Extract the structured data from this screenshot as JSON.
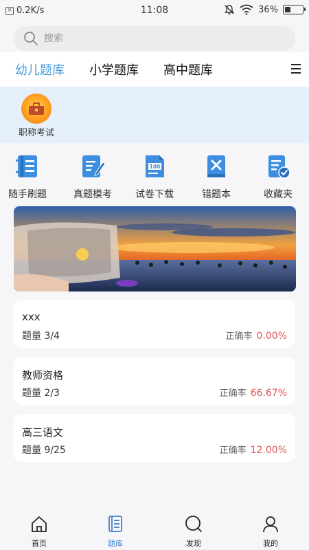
{
  "status_bar": {
    "network_speed": "0.2K/s",
    "time": "11:08",
    "battery": "36%",
    "battery_level": 0.36
  },
  "search": {
    "placeholder": "搜索",
    "value": ""
  },
  "tabs": [
    {
      "label": "幼儿题库",
      "active": true
    },
    {
      "label": "小学题库",
      "active": false
    },
    {
      "label": "高中题库",
      "active": false
    }
  ],
  "categories": [
    {
      "label": "职称考试",
      "icon": "briefcase-badge-icon"
    }
  ],
  "tools": [
    {
      "label": "随手刷题",
      "icon": "practice-book-icon"
    },
    {
      "label": "真题模考",
      "icon": "edit-paper-icon"
    },
    {
      "label": "试卷下载",
      "icon": "score-paper-icon"
    },
    {
      "label": "错题本",
      "icon": "wrong-book-icon"
    },
    {
      "label": "收藏夹",
      "icon": "favorites-check-icon"
    }
  ],
  "banner": {
    "alt": "sunset-sea-phone-photo"
  },
  "question_banks": [
    {
      "name": "xxx",
      "count": "题量 3/4",
      "rate_label": "正确率",
      "rate": "0.00%"
    },
    {
      "name": "教师资格",
      "count": "题量 2/3",
      "rate_label": "正确率",
      "rate": "66.67%"
    },
    {
      "name": "高三语文",
      "count": "题量 9/25",
      "rate_label": "正确率",
      "rate": "12.00%"
    }
  ],
  "bottom_nav": [
    {
      "label": "首页",
      "icon": "home-icon",
      "active": false
    },
    {
      "label": "题库",
      "icon": "question-bank-icon",
      "active": true
    },
    {
      "label": "发现",
      "icon": "discover-icon",
      "active": false
    },
    {
      "label": "我的",
      "icon": "profile-icon",
      "active": false
    }
  ],
  "colors": {
    "accent": "#4a9ad8",
    "tool_icon": "#3d8de0",
    "rate_red": "#e05454",
    "category_band": "#e6f0fb"
  }
}
